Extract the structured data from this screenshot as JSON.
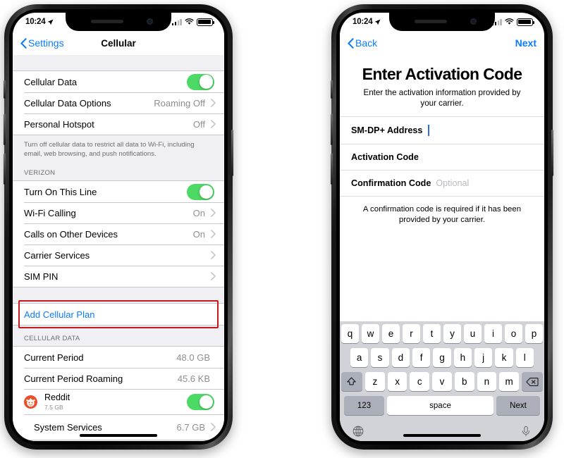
{
  "left_phone": {
    "statusbar": {
      "time": "10:24",
      "location_icon": "location-arrow-icon",
      "signal_icon": "cellular-signal-icon",
      "wifi_icon": "wifi-icon",
      "battery_icon": "battery-icon"
    },
    "navbar": {
      "back_label": "Settings",
      "title": "Cellular",
      "back_icon": "chevron-left-icon"
    },
    "groups": [
      {
        "rows": [
          {
            "label": "Cellular Data",
            "control": "toggle",
            "toggle_on": true
          },
          {
            "label": "Cellular Data Options",
            "value": "Roaming Off",
            "control": "chevron"
          },
          {
            "label": "Personal Hotspot",
            "value": "Off",
            "control": "chevron"
          }
        ],
        "note": "Turn off cellular data to restrict all data to Wi-Fi, including email, web browsing, and push notifications."
      },
      {
        "header": "VERIZON",
        "rows": [
          {
            "label": "Turn On This Line",
            "control": "toggle",
            "toggle_on": true
          },
          {
            "label": "Wi-Fi Calling",
            "value": "On",
            "control": "chevron"
          },
          {
            "label": "Calls on Other Devices",
            "value": "On",
            "control": "chevron"
          },
          {
            "label": "Carrier Services",
            "value": "",
            "control": "chevron"
          },
          {
            "label": "SIM PIN",
            "value": "",
            "control": "chevron"
          }
        ]
      },
      {
        "rows": [
          {
            "label": "Add Cellular Plan",
            "link": true,
            "highlighted": true
          }
        ]
      },
      {
        "header": "CELLULAR DATA",
        "rows": [
          {
            "label": "Current Period",
            "value": "48.0 GB"
          },
          {
            "label": "Current Period Roaming",
            "value": "45.6 KB"
          }
        ],
        "apps": [
          {
            "name": "Reddit",
            "usage": "7.5 GB",
            "icon": "reddit-icon",
            "control": "toggle",
            "toggle_on": true
          },
          {
            "name": "System Services",
            "value": "6.7 GB",
            "control": "chevron"
          }
        ]
      }
    ],
    "toggle_on_color": "#4cd964",
    "link_color": "#0a7cff",
    "highlight_color": "#c4191f"
  },
  "right_phone": {
    "statusbar": {
      "time": "10:24",
      "location_icon": "location-arrow-icon",
      "signal_icon": "cellular-signal-icon",
      "wifi_icon": "wifi-icon",
      "battery_icon": "battery-icon"
    },
    "navbar": {
      "back_label": "Back",
      "next_label": "Next",
      "back_icon": "chevron-left-icon"
    },
    "title": "Enter Activation Code",
    "subtitle": "Enter the activation information provided by your carrier.",
    "fields": [
      {
        "label": "SM-DP+ Address",
        "value": "",
        "placeholder": "",
        "focused": true
      },
      {
        "label": "Activation Code",
        "value": "",
        "placeholder": "",
        "focused": false
      },
      {
        "label": "Confirmation Code",
        "value": "",
        "placeholder": "Optional",
        "focused": false
      }
    ],
    "field_note": "A confirmation code is required if it has been provided by your carrier.",
    "keyboard": {
      "row1": [
        "q",
        "w",
        "e",
        "r",
        "t",
        "y",
        "u",
        "i",
        "o",
        "p"
      ],
      "row2": [
        "a",
        "s",
        "d",
        "f",
        "g",
        "h",
        "j",
        "k",
        "l"
      ],
      "row3": [
        "z",
        "x",
        "c",
        "v",
        "b",
        "n",
        "m"
      ],
      "shift_icon": "shift-arrow-icon",
      "backspace_icon": "backspace-icon",
      "numbers_label": "123",
      "space_label": "space",
      "return_label": "Next",
      "globe_icon": "globe-icon",
      "mic_icon": "microphone-icon"
    }
  }
}
